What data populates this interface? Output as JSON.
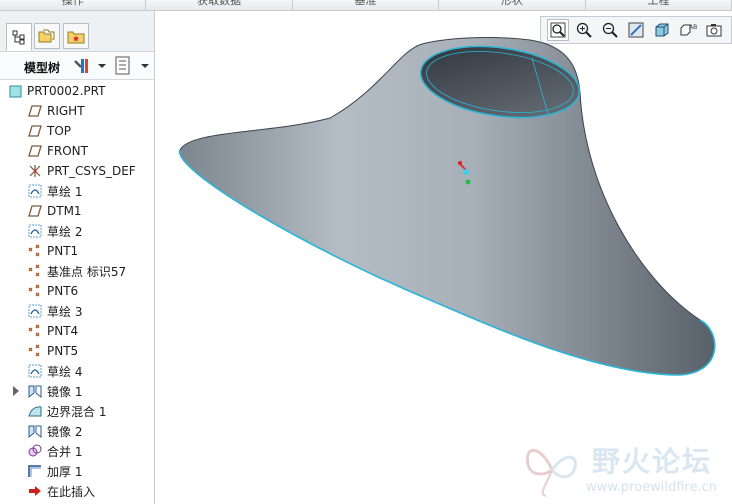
{
  "menu_tabs": [
    "操作",
    "获取数据",
    "基准",
    "形状",
    "工程"
  ],
  "panel": {
    "title": "模型树",
    "items": [
      {
        "label": "PRT0002.PRT",
        "icon": "part-icon"
      },
      {
        "label": "RIGHT",
        "icon": "datum-plane-icon"
      },
      {
        "label": "TOP",
        "icon": "datum-plane-icon"
      },
      {
        "label": "FRONT",
        "icon": "datum-plane-icon"
      },
      {
        "label": "PRT_CSYS_DEF",
        "icon": "csys-icon"
      },
      {
        "label": "草绘 1",
        "icon": "sketch-icon"
      },
      {
        "label": "DTM1",
        "icon": "datum-plane-icon"
      },
      {
        "label": "草绘 2",
        "icon": "sketch-icon"
      },
      {
        "label": "PNT1",
        "icon": "datum-point-icon"
      },
      {
        "label": "基准点 标识57",
        "icon": "datum-point-icon"
      },
      {
        "label": "PNT6",
        "icon": "datum-point-icon"
      },
      {
        "label": "草绘 3",
        "icon": "sketch-icon"
      },
      {
        "label": "PNT4",
        "icon": "datum-point-icon"
      },
      {
        "label": "PNT5",
        "icon": "datum-point-icon"
      },
      {
        "label": "草绘 4",
        "icon": "sketch-icon"
      },
      {
        "label": "镜像 1",
        "icon": "mirror-icon"
      },
      {
        "label": "边界混合 1",
        "icon": "boundary-blend-icon"
      },
      {
        "label": "镜像 2",
        "icon": "mirror-icon"
      },
      {
        "label": "合并 1",
        "icon": "merge-icon"
      },
      {
        "label": "加厚 1",
        "icon": "thicken-icon"
      },
      {
        "label": "在此插入",
        "icon": "insert-here-arrow-icon"
      }
    ]
  },
  "graphics_toolbar": [
    "refit-icon",
    "zoom-in-icon",
    "zoom-out-icon",
    "repaint-icon",
    "display-style-icon",
    "saved-orientations-icon",
    "camera-icon"
  ],
  "watermark": {
    "text": "野火论坛",
    "url": "www.proewildfire.cn"
  }
}
